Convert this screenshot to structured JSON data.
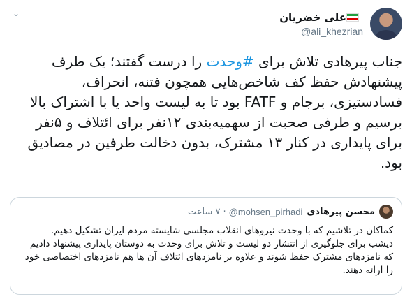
{
  "tweet": {
    "author": {
      "display_name": "علی خضریان",
      "handle": "@ali_khezrian",
      "flag": [
        "#239f40",
        "#ffffff",
        "#da0000"
      ]
    },
    "text_before_hashtag": "جناب پیرهادی تلاش برای ",
    "hashtag": "#وحدت",
    "text_after_hashtag": " را درست گفتند؛ یک طرف پیشنهادش حفظ کف شاخص‌هایی همچون فتنه، انحراف، فسادستیزی، برجام و FATF بود تا به لیست واحد یا با اشتراک بالا برسیم و طرفی صحبت از سهمیه‌بندی ۱۲نفر برای ائتلاف و ۵نفر برای پایداری در کنار ۱۳ مشترک، بدون دخالت طرفین در مصادیق بود."
  },
  "quote": {
    "display_name": "محسن پیرهادی",
    "handle": "@mohsen_pirhadi",
    "separator": "·",
    "time": "۷ ساعت",
    "paragraphs": [
      "کماکان در تلاشیم که با وحدت نیروهای انقلاب مجلسی شایسته مردم ایران تشکیل دهیم.",
      "دیشب برای جلوگیری از انتشار دو لیست و تلاش برای وحدت به دوستان پایداری پیشنهاد دادیم که نامزدهای مشترک حفظ شوند و علاوه بر نامزدهای ائتلاف آن ها هم نامزدهای اختصاصی خود را ارائه دهند."
    ]
  },
  "icons": {
    "menu": "chevron-down-icon"
  },
  "colors": {
    "link": "#1b95e0",
    "muted": "#657786",
    "border": "#ccd6dd"
  }
}
